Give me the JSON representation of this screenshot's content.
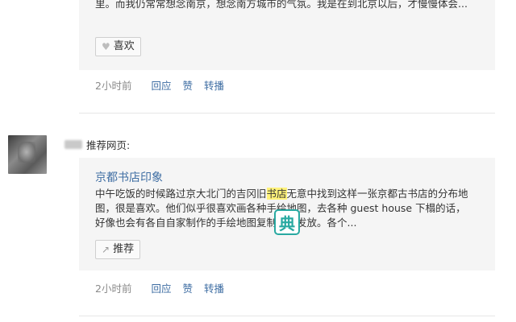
{
  "post1": {
    "excerpt": "里。而我仍常常想念南京，想念南方城市的气氛。我是在到北京以后，才慢慢体会...",
    "like_label": "喜欢",
    "like_icon": "heart-icon",
    "time": "2小时前",
    "actions": [
      "回应",
      "赞",
      "转播"
    ]
  },
  "post2": {
    "action_text": "推荐网页:",
    "card_title": "京都书店印象",
    "excerpt_before": "中午吃饭的时候路过京大北门的吉冈旧",
    "excerpt_highlight": "书店",
    "excerpt_after": "无意中找到这样一张京都古书店的分布地图，很是喜欢。他们似乎很喜欢画各种手绘地图，去各种 guest house 下榻的话，好像也会有各自自家制作的手绘地图复制版本发放。各个...",
    "recommend_label": "推荐",
    "recommend_icon": "share-icon",
    "time": "2小时前",
    "actions": [
      "回应",
      "赞",
      "转播"
    ]
  },
  "overlay": {
    "dict_glyph": "典",
    "dict_icon_color": "#29a9a1"
  },
  "colors": {
    "link": "#3f6ea3",
    "card_bg": "#f5f5f5",
    "highlight": "#fff27a"
  }
}
